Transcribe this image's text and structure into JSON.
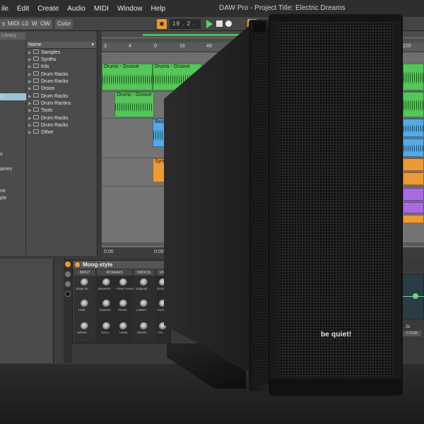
{
  "menu": {
    "items": [
      "ile",
      "Edit",
      "Create",
      "Audio",
      "MIDI",
      "Window",
      "Help"
    ],
    "window_title": "DAW Pro - Project Title: Electric Dreams"
  },
  "toolbar": {
    "buttons": [
      "s",
      "MIDI",
      "L0",
      "W",
      "OW",
      "Color"
    ],
    "position": "19 . 2 . 3"
  },
  "browser": {
    "search_placeholder": "Library",
    "places": [
      "s",
      "s",
      "ames",
      "ne",
      "ple"
    ],
    "name_header": "Name",
    "folders": [
      "Samples",
      "Synths",
      "Kits",
      "Drum Racks",
      "Drum Racks",
      "Oroon",
      "Drum Racks",
      "Drum Ractins",
      "Tools",
      "Drum Racks",
      "Drum Racks",
      "Other"
    ]
  },
  "arrangement": {
    "ruler": [
      "3",
      "4",
      "0",
      "16",
      "48",
      "120"
    ],
    "clips": [
      "Drums - Groove",
      "Drums - Groove",
      "Drums - Groove",
      "Bass",
      "Synt"
    ],
    "time_labels": [
      "0:00",
      "0:00"
    ]
  },
  "device": {
    "title": "Moog-style",
    "sections": [
      "INPUT",
      "RCKAAF5",
      "DROC3L",
      "UNX"
    ],
    "knob_labels": [
      "Slupe 00",
      "Basesri0",
      "Pase Tuone",
      "Dalpastl",
      "Deloress",
      "Haht",
      "Dasomt",
      "Pizato",
      "Laetert",
      "Cassiz",
      "Selnse",
      "Geno",
      "Lenta",
      "Sleedz",
      "Fm"
    ]
  },
  "eq": {
    "label": "2k",
    "button": "CTIOR"
  },
  "case": {
    "brand": "be quiet!"
  }
}
